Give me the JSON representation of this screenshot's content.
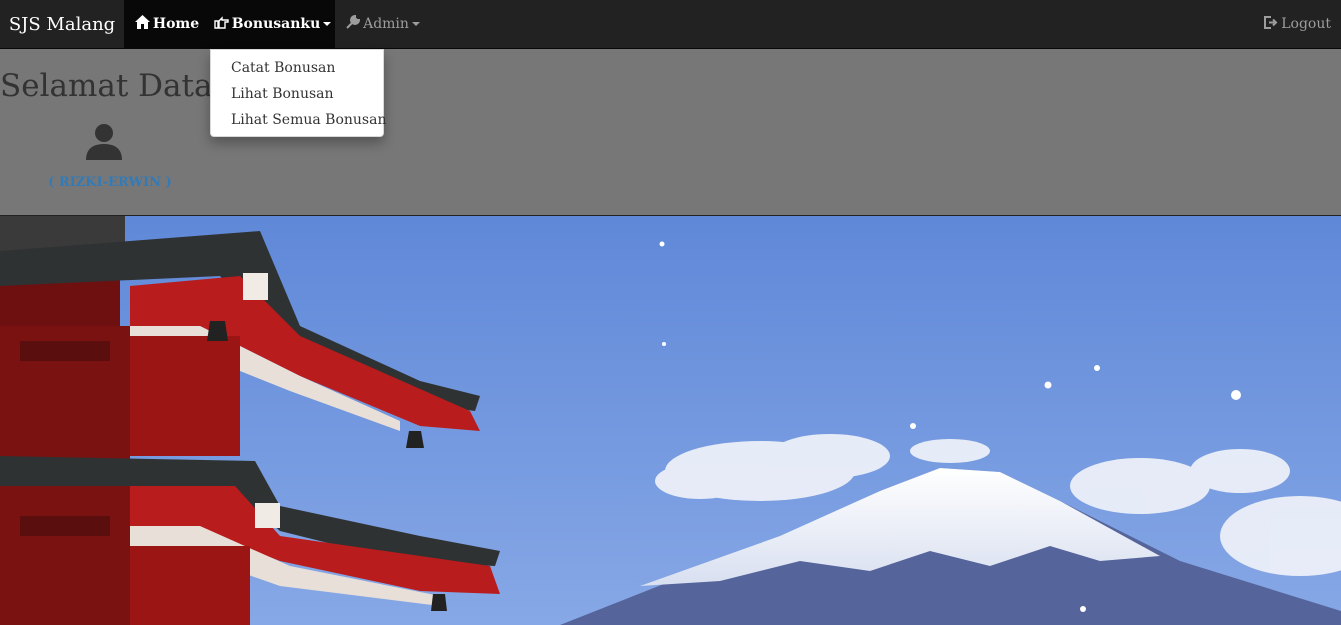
{
  "navbar": {
    "brand": "SJS Malang",
    "home_label": "Home",
    "bonus_label": "Bonusanku",
    "admin_label": "Admin",
    "logout_label": "Logout"
  },
  "dropdown": {
    "items": [
      {
        "label": "Catat Bonusan"
      },
      {
        "label": "Lihat Bonusan"
      },
      {
        "label": "Lihat Semua Bonusan"
      }
    ]
  },
  "header": {
    "welcome": "Selamat Datang",
    "user": "( RIZKI-ERWIN )"
  },
  "colors": {
    "navbar_bg": "#222222",
    "header_bg": "#777777",
    "link_blue": "#337ab7",
    "sky": "#6f95d9",
    "pagoda_red": "#b11a1a"
  },
  "icons": {
    "home": "home-icon",
    "bonus": "hand-pointing-icon",
    "admin": "wrench-icon",
    "logout": "logout-icon",
    "user": "user-icon"
  }
}
